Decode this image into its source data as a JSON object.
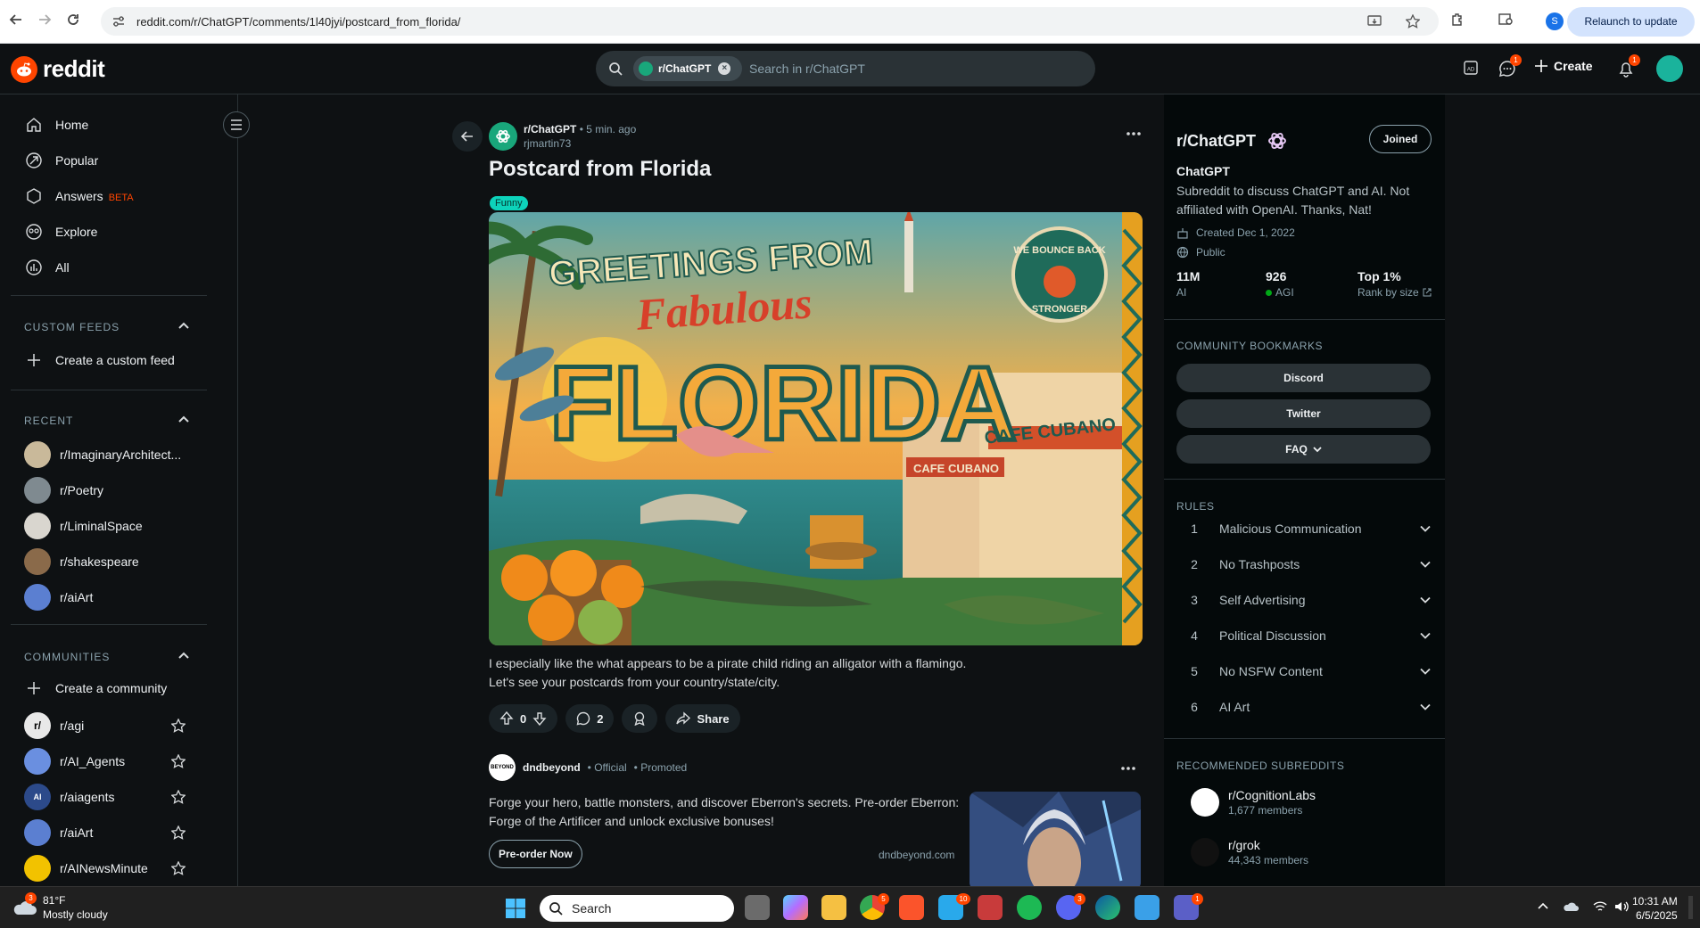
{
  "browser": {
    "url": "reddit.com/r/ChatGPT/comments/1l40jyi/postcard_from_florida/",
    "relaunch_label": "Relaunch to update",
    "profile_initial": "S"
  },
  "header": {
    "logo_text": "reddit",
    "search_chip": "r/ChatGPT",
    "search_placeholder": "Search in r/ChatGPT",
    "chat_badge": "1",
    "create_label": "Create",
    "notif_badge": "1"
  },
  "sidebar": {
    "nav": [
      {
        "label": "Home",
        "icon": "home-icon"
      },
      {
        "label": "Popular",
        "icon": "popular-icon"
      },
      {
        "label": "Answers",
        "icon": "answers-icon",
        "badge": "BETA"
      },
      {
        "label": "Explore",
        "icon": "explore-icon"
      },
      {
        "label": "All",
        "icon": "all-icon"
      }
    ],
    "custom_feeds_title": "CUSTOM FEEDS",
    "create_feed_label": "Create a custom feed",
    "recent_title": "RECENT",
    "recent": [
      {
        "label": "r/ImaginaryArchitect...",
        "color": "#c9b99a"
      },
      {
        "label": "r/Poetry",
        "color": "#7f8a90"
      },
      {
        "label": "r/LiminalSpace",
        "color": "#d9d6cf"
      },
      {
        "label": "r/shakespeare",
        "color": "#8a6a4a"
      },
      {
        "label": "r/aiArt",
        "color": "#5b7fd1"
      }
    ],
    "communities_title": "COMMUNITIES",
    "create_community_label": "Create a community",
    "communities": [
      {
        "label": "r/agi",
        "color": "#e8e8e8",
        "glyph": "r/"
      },
      {
        "label": "r/AI_Agents",
        "color": "#6a8fe0",
        "glyph": ""
      },
      {
        "label": "r/aiagents",
        "color": "#2c4a8a",
        "glyph": "AI"
      },
      {
        "label": "r/aiArt",
        "color": "#5b7fd1",
        "glyph": ""
      },
      {
        "label": "r/AINewsMinute",
        "color": "#f2c200",
        "glyph": ""
      }
    ]
  },
  "post": {
    "subreddit": "r/ChatGPT",
    "time": "• 5 min. ago",
    "author": "rjmartin73",
    "title": "Postcard from Florida",
    "flair": "Funny",
    "image_text": {
      "greeting": "GREETINGS FROM",
      "fabulous": "Fabulous",
      "florida": "FLORIDA",
      "cafe_sign": "CAFE CUBANO",
      "cafe_sign_small": "CAFE CUBANO",
      "badge_top": "WE BOUNCE BACK",
      "badge_bottom": "STRONGER"
    },
    "body_line1": "I especially like the what appears to be a pirate child riding an alligator with a flamingo.",
    "body_line2": "Let's see your postcards from your country/state/city.",
    "votes": "0",
    "comments": "2",
    "share_label": "Share"
  },
  "promo": {
    "advertiser": "dndbeyond",
    "logo_text": "BEYOND",
    "official": "• Official",
    "promoted": "• Promoted",
    "text": "Forge your hero, battle monsters, and discover Eberron's secrets. Pre-order Eberron: Forge of the Artificer and unlock exclusive bonuses!",
    "cta": "Pre-order Now",
    "domain": "dndbeyond.com"
  },
  "community": {
    "title": "r/ChatGPT",
    "joined_label": "Joined",
    "name": "ChatGPT",
    "description": "Subreddit to discuss ChatGPT and AI. Not affiliated with OpenAI. Thanks, Nat!",
    "created": "Created Dec 1, 2022",
    "visibility": "Public",
    "stats": [
      {
        "value": "11M",
        "label": "AI"
      },
      {
        "value": "926",
        "label": "AGI"
      },
      {
        "value": "Top 1%",
        "label": "Rank by size"
      }
    ],
    "bookmarks_title": "COMMUNITY BOOKMARKS",
    "bookmarks": [
      "Discord",
      "Twitter",
      "FAQ"
    ],
    "rules_title": "RULES",
    "rules": [
      {
        "n": "1",
        "t": "Malicious Communication"
      },
      {
        "n": "2",
        "t": "No Trashposts"
      },
      {
        "n": "3",
        "t": "Self Advertising"
      },
      {
        "n": "4",
        "t": "Political Discussion"
      },
      {
        "n": "5",
        "t": "No NSFW Content"
      },
      {
        "n": "6",
        "t": "AI Art"
      }
    ],
    "recommended_title": "RECOMMENDED SUBREDDITS",
    "recommended": [
      {
        "name": "r/CognitionLabs",
        "members": "1,677 members",
        "color": "#ffffff"
      },
      {
        "name": "r/grok",
        "members": "44,343 members",
        "color": "#111111"
      }
    ]
  },
  "taskbar": {
    "temp": "81°F",
    "weather": "Mostly cloudy",
    "weather_badge": "3",
    "search_label": "Search",
    "time": "10:31 AM",
    "date": "6/5/2025",
    "badges": [
      "5",
      "10",
      "3",
      "1"
    ]
  }
}
